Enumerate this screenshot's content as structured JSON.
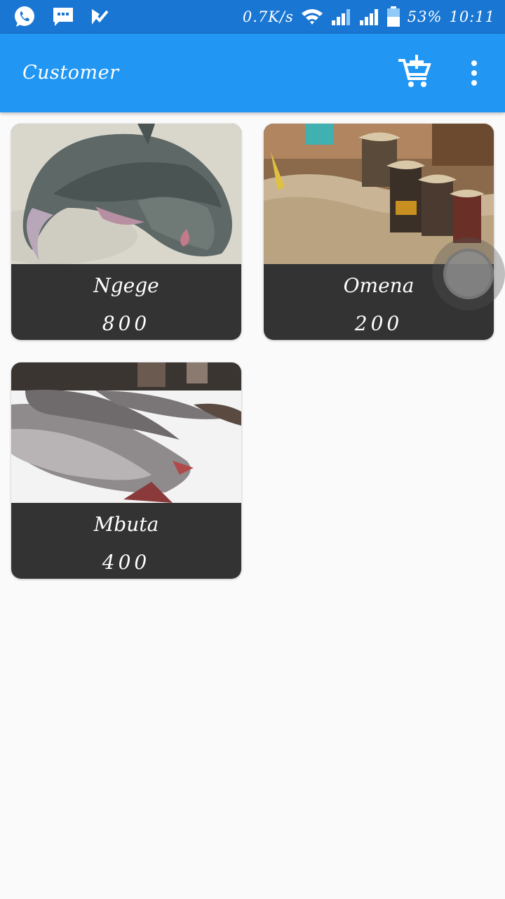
{
  "status_bar": {
    "icons_left": [
      "whatsapp-icon",
      "message-icon",
      "checkmark-app-icon"
    ],
    "network_speed": "0.7K/s",
    "battery": "53%",
    "time": "10:11"
  },
  "app_bar": {
    "title": "Customer",
    "actions": [
      "add-to-cart-icon",
      "more-vert-icon"
    ]
  },
  "products": [
    {
      "name": "Ngege",
      "price": "800"
    },
    {
      "name": "Omena",
      "price": "200"
    },
    {
      "name": "Mbuta",
      "price": "400"
    }
  ],
  "colors": {
    "status_bar": "#1976d2",
    "app_bar": "#2196f3",
    "card_caption": "#333333",
    "background": "#fafafa"
  }
}
